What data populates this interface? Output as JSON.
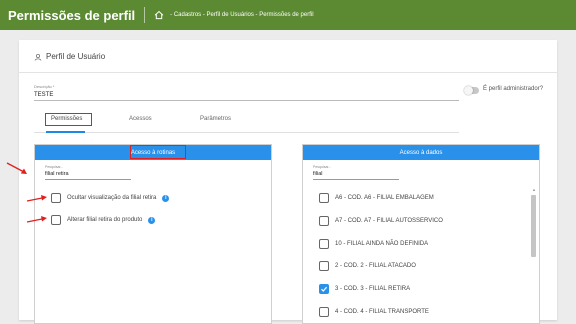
{
  "topbar": {
    "title": "Permissões de perfil",
    "breadcrumb": "- Cadastros - Perfil de Usuários - Permissões de perfil"
  },
  "card": {
    "title": "Perfil de Usuário"
  },
  "form": {
    "description_label": "Descrição *",
    "description_value": "TESTE",
    "admin_label": "É perfil administrador?",
    "admin_on": false
  },
  "tabs": [
    {
      "label": "Permissões",
      "active": true
    },
    {
      "label": "Acessos",
      "active": false
    },
    {
      "label": "Parâmetros",
      "active": false
    }
  ],
  "left_panel": {
    "title": "Acesso à rotinas",
    "search_label": "Pesquisar...",
    "search_value": "filial retira",
    "items": [
      {
        "label": "Ocultar visualização da filial retira",
        "checked": false
      },
      {
        "label": "Alterar filial retira do produto",
        "checked": false
      }
    ]
  },
  "right_panel": {
    "title": "Acesso à dados",
    "search_label": "Pesquisar...",
    "search_value": "filial",
    "items": [
      {
        "label": "A6 - COD. A6 - FILIAL EMBALAGEM",
        "checked": false
      },
      {
        "label": "A7 - COD. A7 - FILIAL AUTOSSERVICO",
        "checked": false
      },
      {
        "label": "10 - FILIAL AINDA NÃO DEFINIDA",
        "checked": false
      },
      {
        "label": "2 - COD. 2 - FILIAL ATACADO",
        "checked": false
      },
      {
        "label": "3 - COD. 3 - FILIAL RETIRA",
        "checked": true
      },
      {
        "label": "4 - COD. 4 - FILIAL TRANSPORTE",
        "checked": false
      }
    ]
  },
  "colors": {
    "topbar": "#5b8a32",
    "accent": "#2a91ea",
    "highlight": "#e02020"
  },
  "icons": {
    "home": "home-icon",
    "profile": "profile-icon",
    "info": "info-icon",
    "check": "check-icon",
    "arrow": "red-arrow-icon"
  }
}
